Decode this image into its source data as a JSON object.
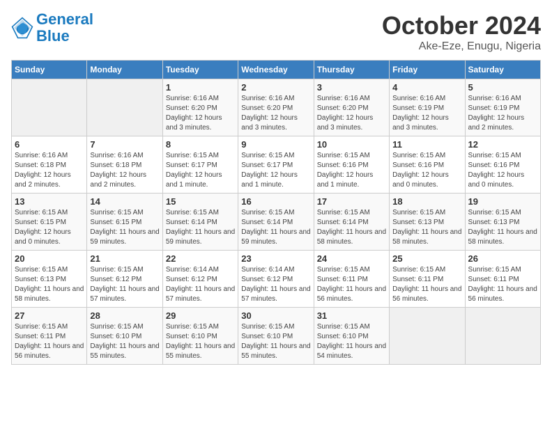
{
  "logo": {
    "line1": "General",
    "line2": "Blue"
  },
  "title": "October 2024",
  "location": "Ake-Eze, Enugu, Nigeria",
  "weekdays": [
    "Sunday",
    "Monday",
    "Tuesday",
    "Wednesday",
    "Thursday",
    "Friday",
    "Saturday"
  ],
  "weeks": [
    [
      {
        "day": "",
        "info": ""
      },
      {
        "day": "",
        "info": ""
      },
      {
        "day": "1",
        "info": "Sunrise: 6:16 AM\nSunset: 6:20 PM\nDaylight: 12 hours and 3 minutes."
      },
      {
        "day": "2",
        "info": "Sunrise: 6:16 AM\nSunset: 6:20 PM\nDaylight: 12 hours and 3 minutes."
      },
      {
        "day": "3",
        "info": "Sunrise: 6:16 AM\nSunset: 6:20 PM\nDaylight: 12 hours and 3 minutes."
      },
      {
        "day": "4",
        "info": "Sunrise: 6:16 AM\nSunset: 6:19 PM\nDaylight: 12 hours and 3 minutes."
      },
      {
        "day": "5",
        "info": "Sunrise: 6:16 AM\nSunset: 6:19 PM\nDaylight: 12 hours and 2 minutes."
      }
    ],
    [
      {
        "day": "6",
        "info": "Sunrise: 6:16 AM\nSunset: 6:18 PM\nDaylight: 12 hours and 2 minutes."
      },
      {
        "day": "7",
        "info": "Sunrise: 6:16 AM\nSunset: 6:18 PM\nDaylight: 12 hours and 2 minutes."
      },
      {
        "day": "8",
        "info": "Sunrise: 6:15 AM\nSunset: 6:17 PM\nDaylight: 12 hours and 1 minute."
      },
      {
        "day": "9",
        "info": "Sunrise: 6:15 AM\nSunset: 6:17 PM\nDaylight: 12 hours and 1 minute."
      },
      {
        "day": "10",
        "info": "Sunrise: 6:15 AM\nSunset: 6:16 PM\nDaylight: 12 hours and 1 minute."
      },
      {
        "day": "11",
        "info": "Sunrise: 6:15 AM\nSunset: 6:16 PM\nDaylight: 12 hours and 0 minutes."
      },
      {
        "day": "12",
        "info": "Sunrise: 6:15 AM\nSunset: 6:16 PM\nDaylight: 12 hours and 0 minutes."
      }
    ],
    [
      {
        "day": "13",
        "info": "Sunrise: 6:15 AM\nSunset: 6:15 PM\nDaylight: 12 hours and 0 minutes."
      },
      {
        "day": "14",
        "info": "Sunrise: 6:15 AM\nSunset: 6:15 PM\nDaylight: 11 hours and 59 minutes."
      },
      {
        "day": "15",
        "info": "Sunrise: 6:15 AM\nSunset: 6:14 PM\nDaylight: 11 hours and 59 minutes."
      },
      {
        "day": "16",
        "info": "Sunrise: 6:15 AM\nSunset: 6:14 PM\nDaylight: 11 hours and 59 minutes."
      },
      {
        "day": "17",
        "info": "Sunrise: 6:15 AM\nSunset: 6:14 PM\nDaylight: 11 hours and 58 minutes."
      },
      {
        "day": "18",
        "info": "Sunrise: 6:15 AM\nSunset: 6:13 PM\nDaylight: 11 hours and 58 minutes."
      },
      {
        "day": "19",
        "info": "Sunrise: 6:15 AM\nSunset: 6:13 PM\nDaylight: 11 hours and 58 minutes."
      }
    ],
    [
      {
        "day": "20",
        "info": "Sunrise: 6:15 AM\nSunset: 6:13 PM\nDaylight: 11 hours and 58 minutes."
      },
      {
        "day": "21",
        "info": "Sunrise: 6:15 AM\nSunset: 6:12 PM\nDaylight: 11 hours and 57 minutes."
      },
      {
        "day": "22",
        "info": "Sunrise: 6:14 AM\nSunset: 6:12 PM\nDaylight: 11 hours and 57 minutes."
      },
      {
        "day": "23",
        "info": "Sunrise: 6:14 AM\nSunset: 6:12 PM\nDaylight: 11 hours and 57 minutes."
      },
      {
        "day": "24",
        "info": "Sunrise: 6:15 AM\nSunset: 6:11 PM\nDaylight: 11 hours and 56 minutes."
      },
      {
        "day": "25",
        "info": "Sunrise: 6:15 AM\nSunset: 6:11 PM\nDaylight: 11 hours and 56 minutes."
      },
      {
        "day": "26",
        "info": "Sunrise: 6:15 AM\nSunset: 6:11 PM\nDaylight: 11 hours and 56 minutes."
      }
    ],
    [
      {
        "day": "27",
        "info": "Sunrise: 6:15 AM\nSunset: 6:11 PM\nDaylight: 11 hours and 56 minutes."
      },
      {
        "day": "28",
        "info": "Sunrise: 6:15 AM\nSunset: 6:10 PM\nDaylight: 11 hours and 55 minutes."
      },
      {
        "day": "29",
        "info": "Sunrise: 6:15 AM\nSunset: 6:10 PM\nDaylight: 11 hours and 55 minutes."
      },
      {
        "day": "30",
        "info": "Sunrise: 6:15 AM\nSunset: 6:10 PM\nDaylight: 11 hours and 55 minutes."
      },
      {
        "day": "31",
        "info": "Sunrise: 6:15 AM\nSunset: 6:10 PM\nDaylight: 11 hours and 54 minutes."
      },
      {
        "day": "",
        "info": ""
      },
      {
        "day": "",
        "info": ""
      }
    ]
  ]
}
